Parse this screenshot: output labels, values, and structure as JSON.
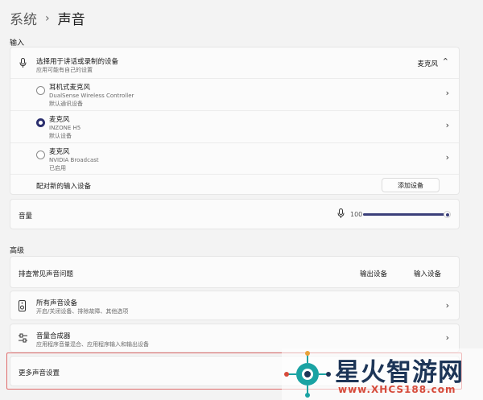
{
  "breadcrumb": {
    "root": "系统",
    "separator": "›",
    "current": "声音"
  },
  "input": {
    "section_label": "输入",
    "choose_device": {
      "title": "选择用于讲话或录制的设备",
      "subtitle": "应用可能有自己的设置",
      "value": "麦克风"
    },
    "devices": [
      {
        "name": "耳机式麦克风",
        "device": "DualSense Wireless Controller",
        "status": "默认通讯设备",
        "selected": false
      },
      {
        "name": "麦克风",
        "device": "INZONE H5",
        "status": "默认设备",
        "selected": true
      },
      {
        "name": "麦克风",
        "device": "NVIDIA Broadcast",
        "status": "已启用",
        "selected": false
      }
    ],
    "pair": {
      "label": "配对新的输入设备",
      "button": "添加设备"
    },
    "volume": {
      "label": "音量",
      "value": "100",
      "level": 1.0
    }
  },
  "advanced": {
    "section_label": "高级",
    "troubleshoot": {
      "label": "排查常见声音问题",
      "output_button": "输出设备",
      "input_button": "输入设备"
    },
    "all_devices": {
      "title": "所有声音设备",
      "subtitle": "开启/关闭设备、排除故障、其他选项"
    },
    "mixer": {
      "title": "音量合成器",
      "subtitle": "应用程序音量混合、应用程序输入和输出设备"
    },
    "more": {
      "label": "更多声音设置"
    }
  },
  "watermark": {
    "text": "星火智游网",
    "url": "www.XHCS188.com"
  },
  "colors": {
    "accent": "#2b2f6e",
    "highlight": "#e06a6a",
    "watermark_text": "#1d3557",
    "watermark_url": "#d64b3b"
  }
}
